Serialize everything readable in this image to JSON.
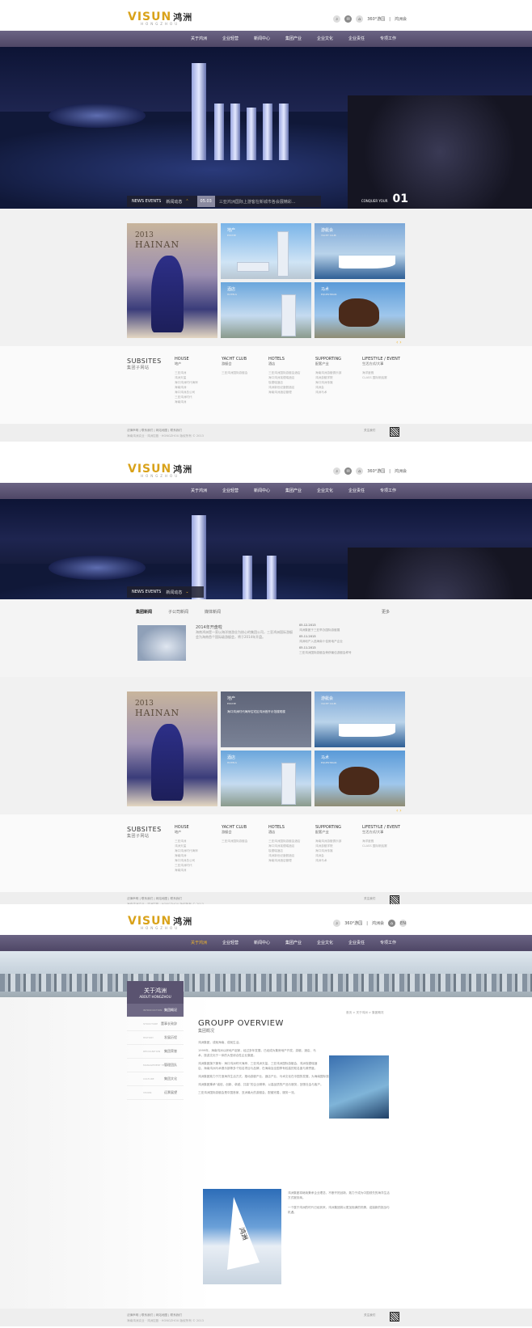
{
  "logo": {
    "brand": "VISUN",
    "cn": "鸿洲",
    "tag": "HONGZHOU"
  },
  "header": {
    "links": [
      "360°游园",
      "鸿洲会"
    ],
    "lang": "EN"
  },
  "nav": {
    "items": [
      "关于鸿洲",
      "企业轻营",
      "新闻中心",
      "集团产业",
      "企业文化",
      "企业责任",
      "专项工作"
    ]
  },
  "hero": {
    "news_label": "NEWS EVENTS",
    "news_cn": "新闻动态",
    "date": "05.03",
    "headline": "三亚鸿洲国际上游客在新城市各会展精彩...",
    "concept": "CONQUER YOUR",
    "concept2": "鸿洲会",
    "num": "01"
  },
  "gallery": {
    "year": "2013",
    "place": "HAINAN",
    "tiles": [
      {
        "cn": "地产",
        "en": "ESTATE"
      },
      {
        "cn": "游艇会",
        "en": "YACHT CLUB"
      },
      {
        "cn": "酒店",
        "en": "HOTELS"
      },
      {
        "cn": "马术",
        "en": "EQUESTRIAN"
      }
    ],
    "tile2_caption": "海口鸿洲时代海岸住宅区鸿洲首开示范楼现楼"
  },
  "subsites": {
    "title": "SUBSITES",
    "cn": "集团子网站",
    "cols": [
      {
        "en": "HOUSE",
        "cn": "地产",
        "items": [
          "三亚鸿洲",
          "鸿洲天玺",
          "海口鸿洲时代海岸",
          "海南鸿洲·",
          "海口鸿洲总公司",
          "三亚鸿洲时代",
          "海南鸿洲"
        ]
      },
      {
        "en": "YACHT CLUB",
        "cn": "游艇会",
        "items": [
          "三亚鸿洲国际游艇会"
        ]
      },
      {
        "en": "HOTELS",
        "cn": "酒店",
        "items": [
          "三亚鸿洲国际游艇会酒店",
          "海口鸿洲埃德瑞酒店",
          "埃德瑞酒店",
          "鸿洲新世纪度假酒店",
          "海南鸿洲酒店管理"
        ]
      },
      {
        "en": "SUPPORTING",
        "cn": "配套产业",
        "items": [
          "海南鸿洲游艇俱乐部",
          "鸿洲游艇学院",
          "海口鸿洲传媒",
          "鸿洲会",
          "鸿洲马术"
        ]
      },
      {
        "en": "LIFESTYLE / EVENT",
        "cn": "生活方式/大事",
        "items": [
          "海洋度假",
          "CLASS 国际帆船赛"
        ]
      }
    ]
  },
  "footer": {
    "links": [
      "法律声明",
      "联系我们",
      "网站地图",
      "联系我们"
    ],
    "copyright": "海南鸿洲实业 · 鸿洲控股 · HONGZHOU 版权所有 © 2013",
    "share": "关注我们"
  },
  "news": {
    "tabs": [
      "集团新闻",
      "子公司新闻",
      "媒体新闻"
    ],
    "tabs_en": [
      "GROUP",
      "COMPANY",
      "MEDIA"
    ],
    "more": "更多",
    "feature_title": "2014年开盘啦",
    "feature_text": "海南鸿洲是一家以海洋旅游业为核心的集团公司，三亚鸿洲国际游艇会为海南首个国际级游艇会，将于2014年开盘。",
    "list": [
      {
        "d": "05.12.2013",
        "t": "鸿洲集团于三亚举办国际游艇展"
      },
      {
        "d": "05.11.2013",
        "t": "鸿洲地产入选海南十佳房地产企业"
      },
      {
        "d": "05.11.2013",
        "t": "三亚鸿洲国际游艇会荣获最佳游艇会称号"
      }
    ]
  },
  "about": {
    "title": "关于鸿洲",
    "en": "ABOUT HONGZHOU",
    "menu": [
      {
        "en": "INTRODUCTION",
        "cn": "集团概况"
      },
      {
        "en": "STRUCTURE",
        "cn": "董事长致辞"
      },
      {
        "en": "HISTORY",
        "cn": "发展历程"
      },
      {
        "en": "RECOGNITION",
        "cn": "集团荣誉"
      },
      {
        "en": "MANAGEMENT TEAM",
        "cn": "管理团队"
      },
      {
        "en": "CULTURE",
        "cn": "集团文化"
      },
      {
        "en": "VISION",
        "cn": "远景展望"
      }
    ],
    "crumb": "首页 > 关于鸿洲 > 集团概况",
    "h1": "GROUPP OVERVIEW",
    "h1cn": "集团概况",
    "p1": "鸿洲集团，成就海南、成就生活。",
    "p2": "1999年，海南鸿洲以房地产起家，经过多年发展，已经成为集房地产开发、游艇、酒店、马术、旅游文化于一体的大型综合性企业集团。",
    "p3": "鸿洲集团旗下拥有：海口鸿洲时代海岸、三亚鸿洲天玺、三亚鸿洲国际游艇会、鸿洲埃德瑞酒店、海南鸿洲马术俱乐部等多个知名项目与品牌，在海南及全国享有较高的知名度与美誉度。",
    "p4": "鸿洲集团致力于打造海洋生活方式，推动游艇产业、酒店产业、马术文化在中国的发展，为海南国际旅游岛建设贡献力量。",
    "p5": "鸿洲集团秉承“诚信、创新、卓越、共赢”的企业精神，以高品质的产品与服务，回馈社会与客户。",
    "p6": "三亚鸿洲国际游艇会是中国首家、亚洲最大的游艇会，配套完善，服务一流。",
    "p7": "鸿洲集团将继续秉承企业理念，不断开拓创新，致力于成为中国领先的海洋生活方式服务商。",
    "p8": "一个属于鸿洲的时代已经到来，鸿洲集团将以更加饱满的热情，迎接新的挑战与机遇。",
    "sail": "鸿洲"
  }
}
